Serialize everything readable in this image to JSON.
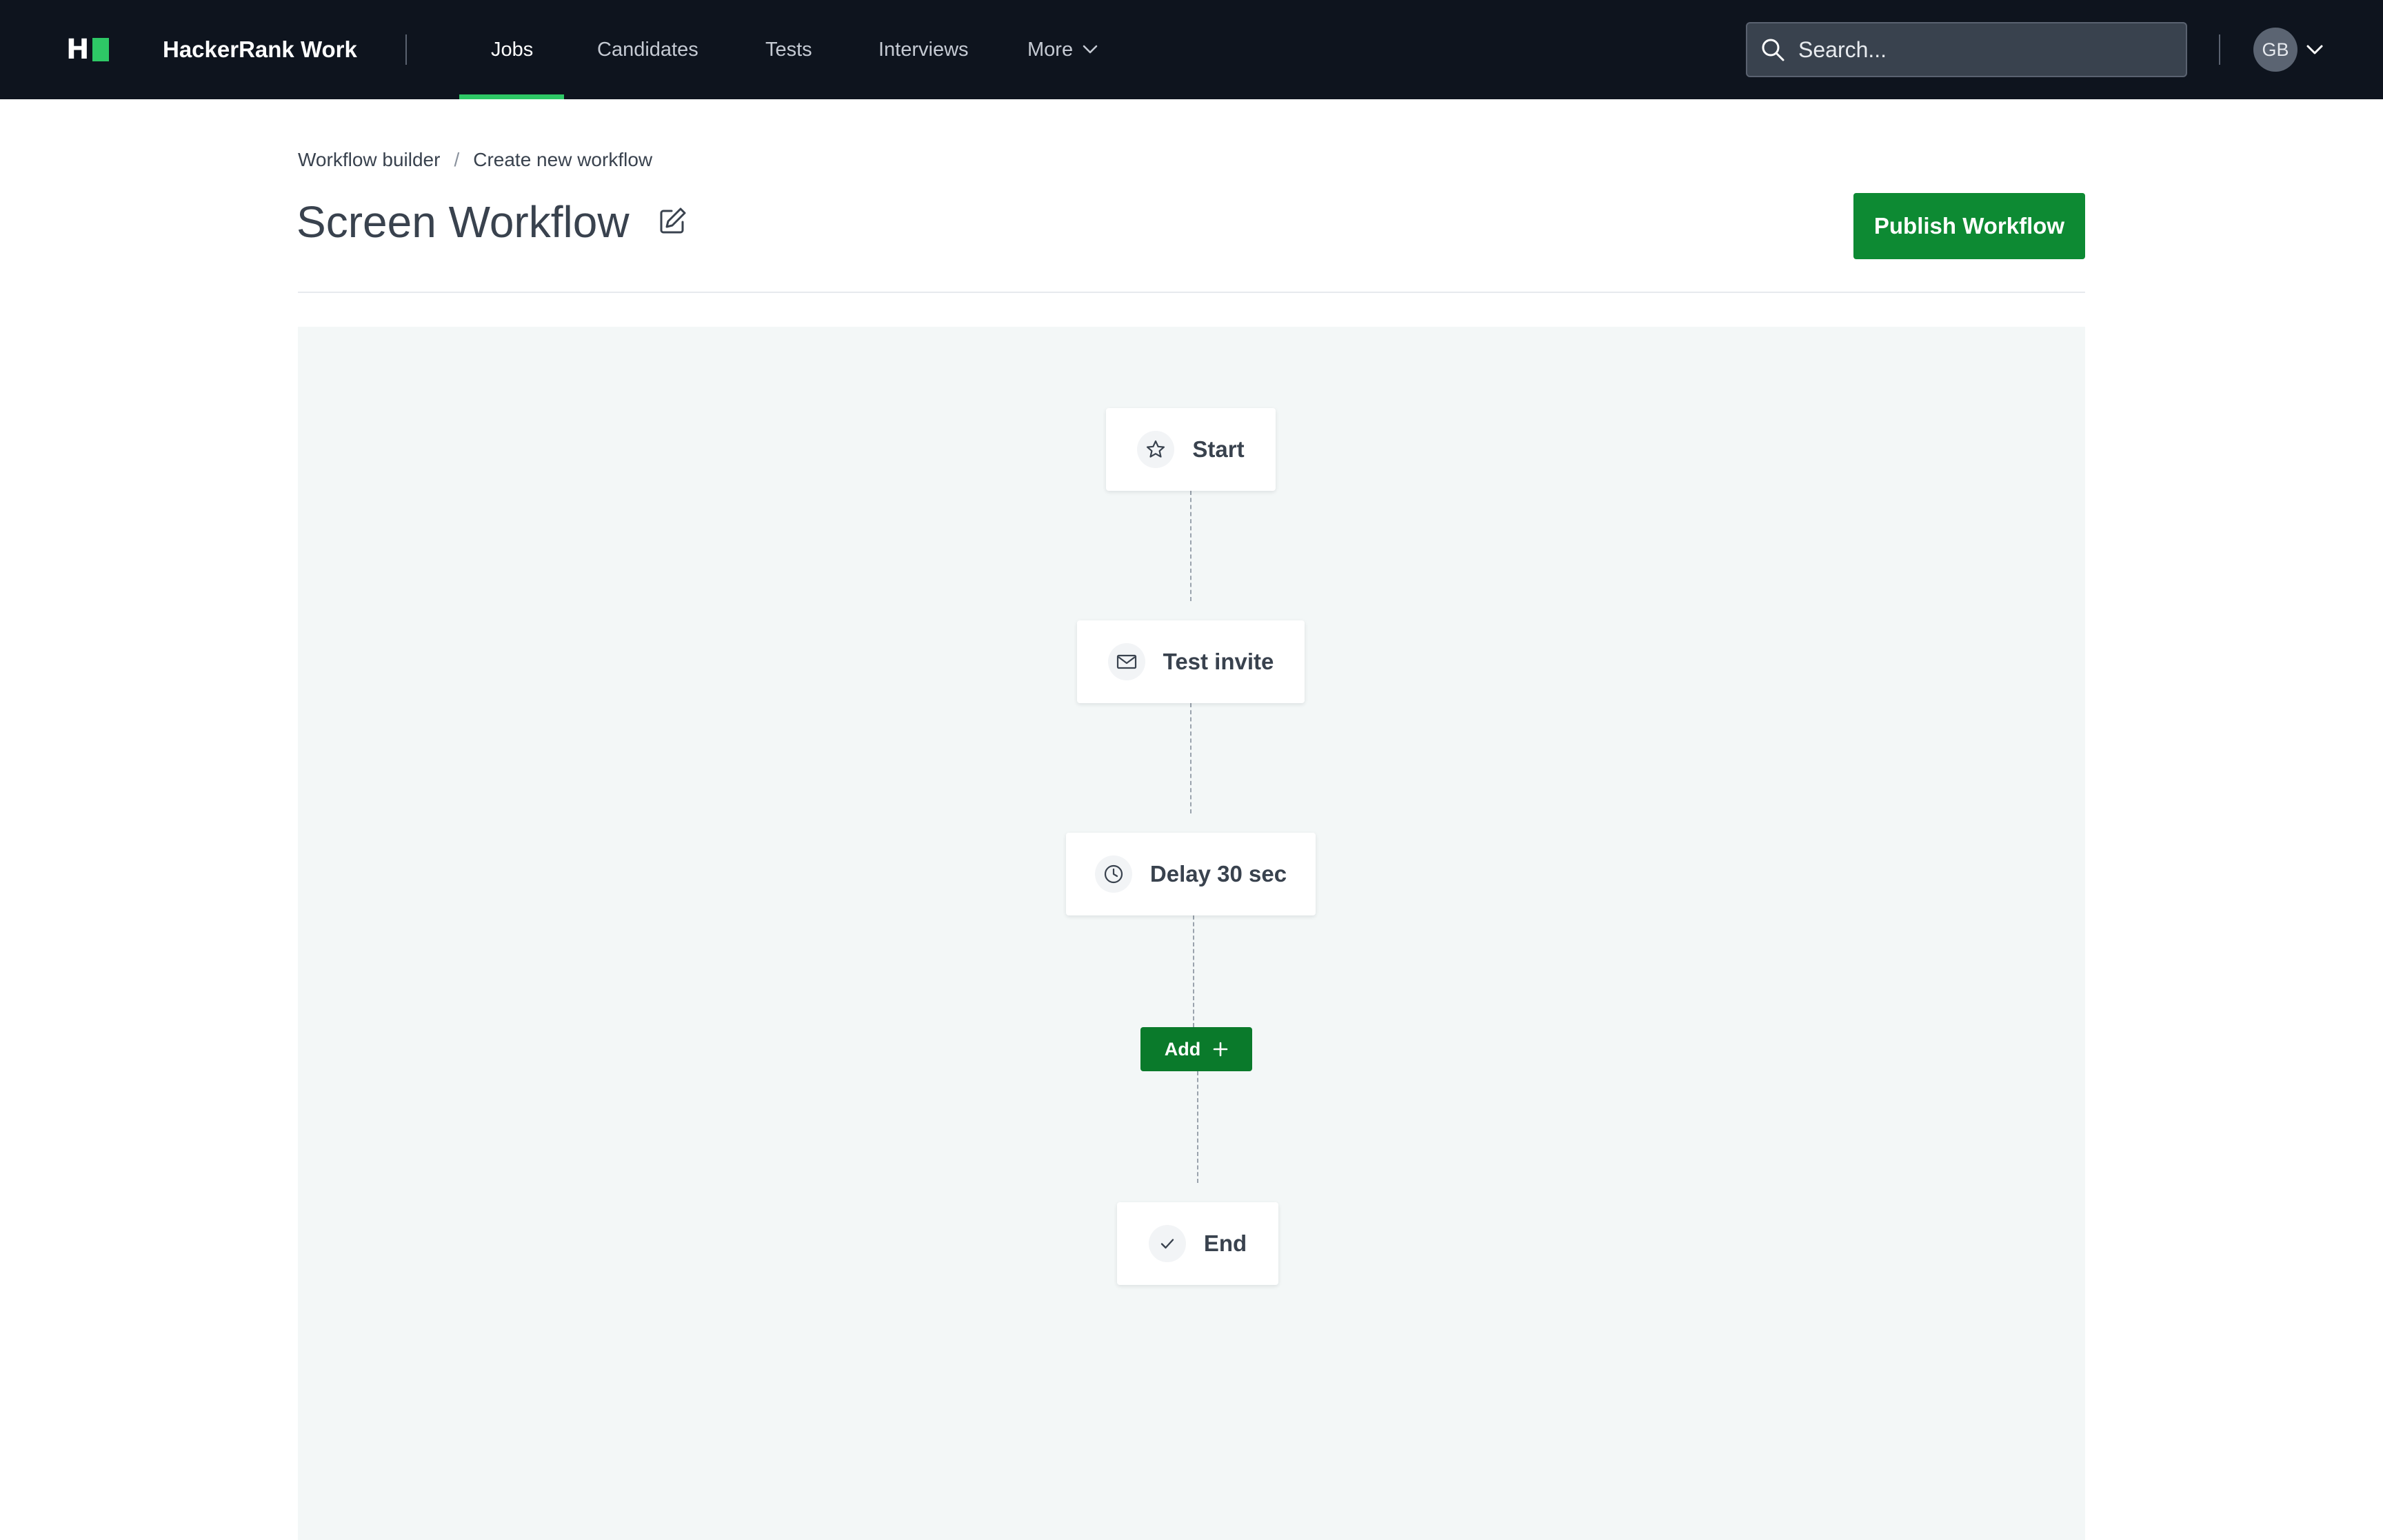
{
  "app": {
    "logo_text": "H",
    "brand": "HackerRank Work"
  },
  "nav": {
    "items": [
      {
        "label": "Jobs",
        "active": true
      },
      {
        "label": "Candidates",
        "active": false
      },
      {
        "label": "Tests",
        "active": false
      },
      {
        "label": "Interviews",
        "active": false
      },
      {
        "label": "More",
        "active": false
      }
    ]
  },
  "search": {
    "placeholder": "Search..."
  },
  "user": {
    "initials": "GB"
  },
  "breadcrumb": {
    "items": [
      "Workflow builder",
      "Create new workflow"
    ],
    "separator": "/"
  },
  "page": {
    "title": "Screen Workflow",
    "publish_label": "Publish Workflow"
  },
  "workflow": {
    "steps": [
      {
        "label": "Start",
        "icon": "star-icon"
      },
      {
        "label": "Test invite",
        "icon": "envelope-icon"
      },
      {
        "label": "Delay 30 sec",
        "icon": "clock-icon"
      }
    ],
    "add_label": "Add",
    "end": {
      "label": "End",
      "icon": "check-icon"
    }
  },
  "colors": {
    "topbar": "#0e141e",
    "accent_green": "#2ec866",
    "primary_button": "#0d8a33",
    "canvas_bg": "#f3f7f7"
  }
}
